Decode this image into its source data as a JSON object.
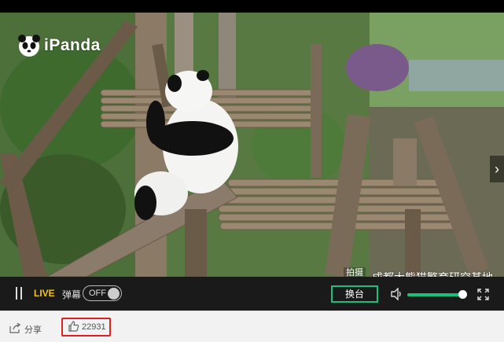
{
  "brand": {
    "name": "iPanda",
    "logo_icon": "panda-logo-icon"
  },
  "video": {
    "location_tag": "拍摄地点",
    "location_name": "成都大熊猫繁育研究基地",
    "next_icon": "chevron-right-icon"
  },
  "controls": {
    "pause_icon": "pause-icon",
    "live_label": "LIVE",
    "danmu_label": "弹幕",
    "danmu_toggle": "OFF",
    "switch_label": "换台",
    "volume_icon": "volume-icon",
    "volume_level": 0.93,
    "fullscreen_icon": "fullscreen-icon",
    "accent_color": "#19c07a",
    "live_color": "#f5c518"
  },
  "footer": {
    "share_label": "分享",
    "share_icon": "share-icon",
    "like_count": "22931",
    "like_icon": "thumbs-up-icon",
    "highlight_color": "#e02020"
  }
}
